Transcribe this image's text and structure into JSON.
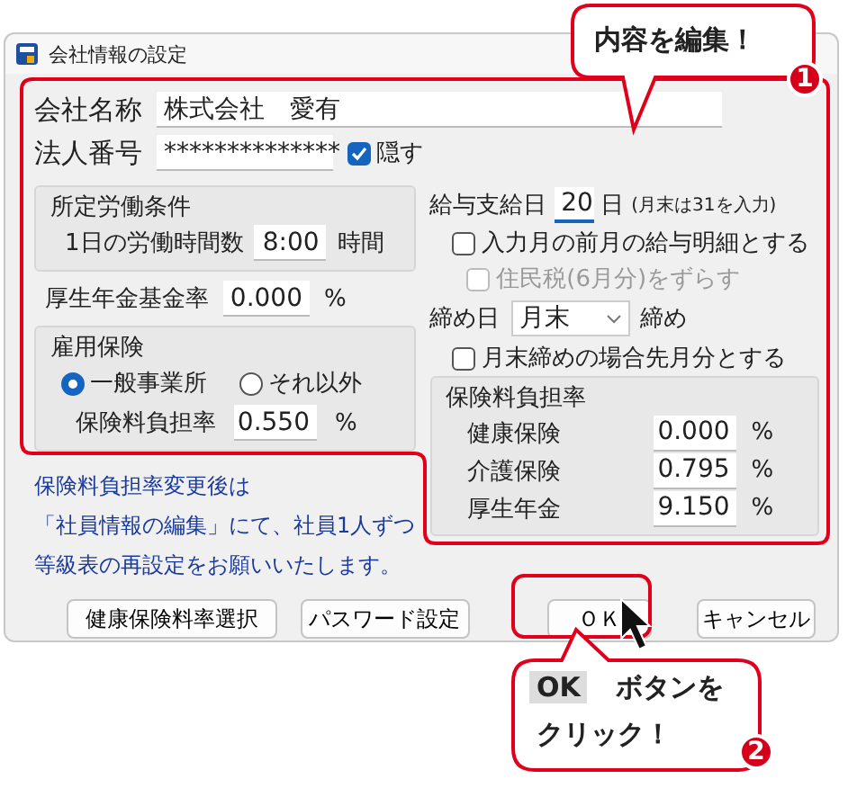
{
  "window": {
    "title": "会社情報の設定"
  },
  "company_name": {
    "label": "会社名称",
    "value": "株式会社　愛有"
  },
  "corporate_number": {
    "label": "法人番号",
    "value": "**************",
    "hide": {
      "label": "隠す",
      "checked": true
    }
  },
  "working_conditions": {
    "title": "所定労働条件",
    "label": "1日の労働時間数",
    "value": "8:00",
    "unit": "時間"
  },
  "pension_fund_rate": {
    "label": "厚生年金基金率",
    "value": "0.000",
    "unit": "%"
  },
  "employment_insurance": {
    "title": "雇用保険",
    "options": [
      {
        "label": "一般事業所",
        "selected": true
      },
      {
        "label": "それ以外",
        "selected": false
      }
    ],
    "rate_label": "保険料負担率",
    "value": "0.550",
    "unit": "%"
  },
  "payday": {
    "label": "給与支給日",
    "value": "20",
    "unit": "日",
    "note": "(月末は31を入力)"
  },
  "payday_options": [
    {
      "label": "入力月の前月の給与明細とする",
      "checked": false,
      "disabled": false
    },
    {
      "label": "住民税(6月分)をずらす",
      "checked": false,
      "disabled": true
    }
  ],
  "closing_day": {
    "label": "締め日",
    "value": "月末",
    "suffix": "締め"
  },
  "closing_option": {
    "label": "月末締めの場合先月分とする",
    "checked": false
  },
  "insurance_burden": {
    "title": "保険料負担率",
    "rows": [
      {
        "label": "健康保険",
        "value": "0.000",
        "unit": "%"
      },
      {
        "label": "介護保険",
        "value": "0.795",
        "unit": "%"
      },
      {
        "label": "厚生年金",
        "value": "9.150",
        "unit": "%"
      }
    ]
  },
  "notice": [
    "保険料負担率変更後は",
    "「社員情報の編集」にて、社員1人ずつ",
    "等級表の再設定をお願いいたします。"
  ],
  "buttons": [
    {
      "label": "健康保険料率選択",
      "highlighted": false
    },
    {
      "label": "パスワード設定",
      "highlighted": false
    },
    {
      "label": "ＯＫ",
      "highlighted": true
    },
    {
      "label": "キャンセル",
      "highlighted": false
    }
  ],
  "callouts": [
    {
      "number": "1",
      "text": "内容を編集！"
    },
    {
      "number": "2",
      "key_label": "OK",
      "text": "ボタンを",
      "line2": "クリック！"
    }
  ]
}
